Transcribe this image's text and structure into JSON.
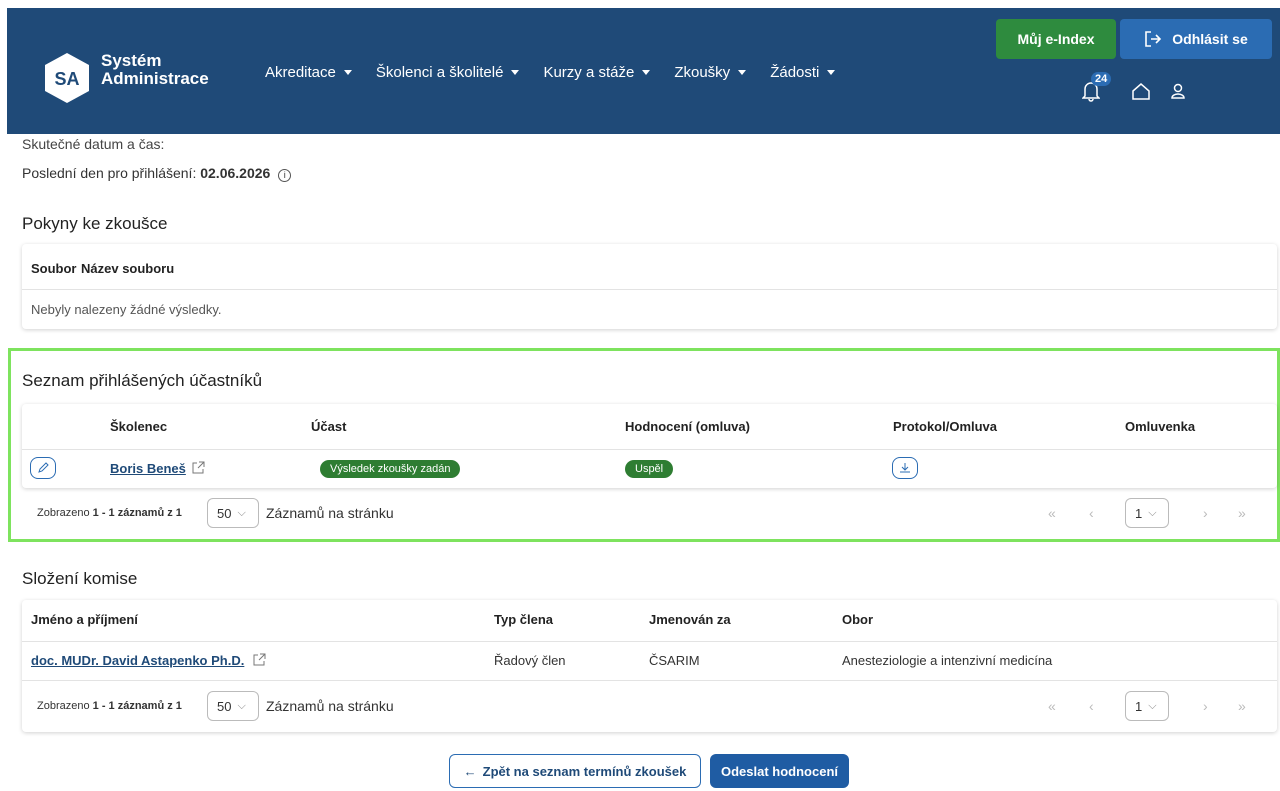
{
  "header": {
    "logo_initials": "SA",
    "app_name_line1": "Systém",
    "app_name_line2": "Administrace",
    "nav": [
      "Akreditace",
      "Školenci a školitelé",
      "Kurzy a stáže",
      "Zkoušky",
      "Žádosti"
    ],
    "eindex_label": "Můj e-Index",
    "logout_label": "Odhlásit se",
    "notification_count": "24",
    "brand_color": "#1f4a78"
  },
  "exam": {
    "partial_label": "Skutečné datum a čas:",
    "deadline_label": "Poslední den pro přihlášení:",
    "deadline_value": "02.06.2026"
  },
  "instructions": {
    "title": "Pokyny ke zkoušce",
    "columns": [
      "Soubor",
      "Název souboru"
    ],
    "empty_text": "Nebyly nalezeny žádné výsledky."
  },
  "participants": {
    "title": "Seznam přihlášených účastníků",
    "columns": [
      "Školenec",
      "Účast",
      "Hodnocení (omluva)",
      "Protokol/Omluva",
      "Omluvenka"
    ],
    "rows": [
      {
        "name": "Boris Beneš",
        "participation": "Výsledek zkoušky zadán",
        "evaluation": "Uspěl"
      }
    ],
    "pager_prefix": "Zobrazeno",
    "pager_range": "1 - 1 záznamů z 1",
    "page_size": "50",
    "per_page_label": "Záznamů na stránku",
    "current_page": "1"
  },
  "committee": {
    "title": "Složení komise",
    "columns": [
      "Jméno a příjmení",
      "Typ člena",
      "Jmenován za",
      "Obor"
    ],
    "rows": [
      {
        "name": "doc. MUDr. David Astapenko Ph.D.",
        "type": "Řadový člen",
        "appointed_by": "ČSARIM",
        "field": "Anesteziologie a intenzivní medicína"
      }
    ],
    "pager_prefix": "Zobrazeno",
    "pager_range": "1 - 1 záznamů z 1",
    "page_size": "50",
    "per_page_label": "Záznamů na stránku",
    "current_page": "1"
  },
  "actions": {
    "back_label": "Zpět na seznam termínů zkoušek",
    "submit_label": "Odeslat hodnocení"
  }
}
